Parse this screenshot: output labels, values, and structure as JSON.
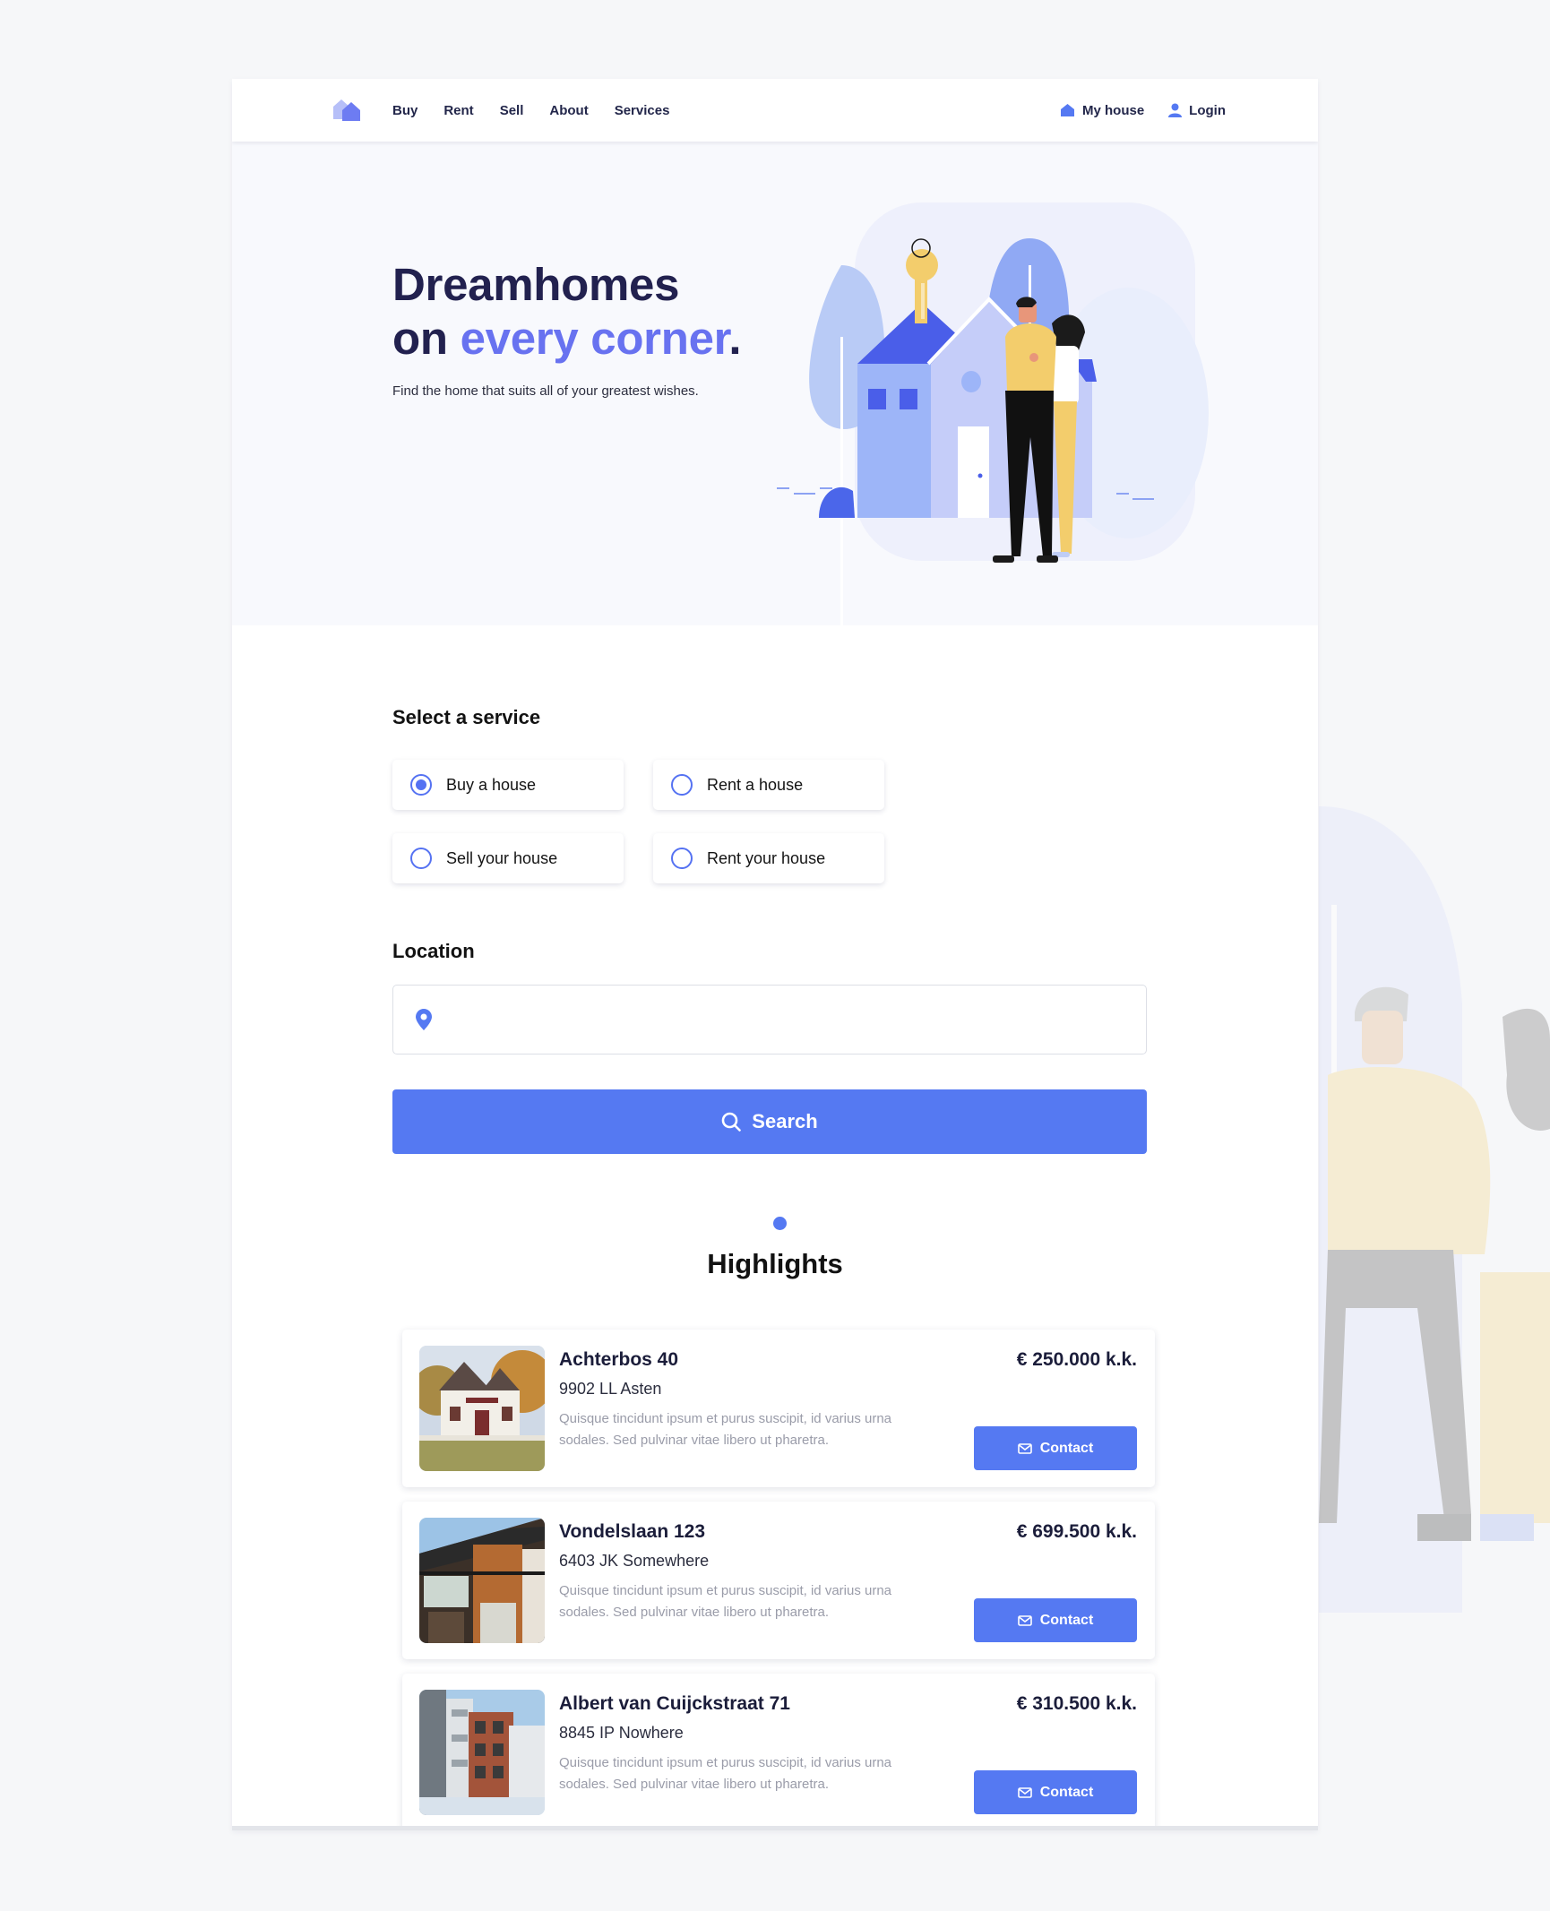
{
  "nav": {
    "links": [
      "Buy",
      "Rent",
      "Sell",
      "About",
      "Services"
    ],
    "my_house": "My house",
    "login": "Login"
  },
  "hero": {
    "title_line1": "Dreamhomes",
    "title_on": "on ",
    "title_accent": "every corner",
    "title_dot": ".",
    "subtitle": "Find the home that suits all of your greatest wishes."
  },
  "service": {
    "heading": "Select a service",
    "options": [
      {
        "label": "Buy a house",
        "selected": true
      },
      {
        "label": "Rent a house",
        "selected": false
      },
      {
        "label": "Sell your house",
        "selected": false
      },
      {
        "label": "Rent your house",
        "selected": false
      }
    ]
  },
  "location": {
    "heading": "Location",
    "value": "",
    "placeholder": ""
  },
  "search": {
    "label": "Search"
  },
  "highlights": {
    "heading": "Highlights",
    "listings": [
      {
        "name": "Achterbos 40",
        "zip": "9902 LL Asten",
        "description": "Quisque tincidunt ipsum et purus suscipit, id varius urna sodales. Sed pulvinar vitae libero ut pharetra.",
        "price": "€ 250.000 k.k.",
        "contact": "Contact",
        "image": "cottage-photo"
      },
      {
        "name": "Vondelslaan 123",
        "zip": "6403 JK Somewhere",
        "description": "Quisque tincidunt ipsum et purus suscipit, id varius urna sodales. Sed pulvinar vitae libero ut pharetra.",
        "price": "€ 699.500 k.k.",
        "contact": "Contact",
        "image": "modern-house-photo"
      },
      {
        "name": "Albert van Cuijckstraat 71",
        "zip": "8845 IP Nowhere",
        "description": "Quisque tincidunt ipsum et purus suscipit, id varius urna sodales. Sed pulvinar vitae libero ut pharetra.",
        "price": "€ 310.500 k.k.",
        "contact": "Contact",
        "image": "apartment-photo"
      }
    ]
  },
  "colors": {
    "accent": "#5579f2",
    "title": "#22214f",
    "accent_text": "#6872f0",
    "background": "#f6f7f9"
  }
}
